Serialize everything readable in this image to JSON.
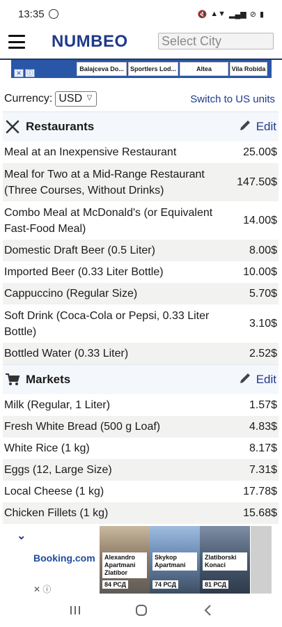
{
  "status_bar": {
    "time": "13:35"
  },
  "header": {
    "logo": "NUMBEO",
    "city_placeholder": "Select City"
  },
  "ad_strip": {
    "cards": [
      "Balajceva Do...",
      "Sportlers Lod...",
      "Altea",
      "Vila Robida"
    ]
  },
  "currency": {
    "label": "Currency:",
    "selected": "USD",
    "units_link": "Switch to US units"
  },
  "restaurants": {
    "title": "Restaurants",
    "edit": "Edit",
    "items": [
      {
        "label": "Meal at an Inexpensive Restaurant",
        "price": "25.00$"
      },
      {
        "label": "Meal for Two at a Mid-Range Restaurant (Three Courses, Without Drinks)",
        "price": "147.50$"
      },
      {
        "label": "Combo Meal at McDonald's (or Equivalent Fast-Food Meal)",
        "price": "14.00$"
      },
      {
        "label": "Domestic Draft Beer (0.5 Liter)",
        "price": "8.00$"
      },
      {
        "label": "Imported Beer (0.33 Liter Bottle)",
        "price": "10.00$"
      },
      {
        "label": "Cappuccino (Regular Size)",
        "price": "5.70$"
      },
      {
        "label": "Soft Drink (Coca-Cola or Pepsi, 0.33 Liter Bottle)",
        "price": "3.10$"
      },
      {
        "label": "Bottled Water (0.33 Liter)",
        "price": "2.52$"
      }
    ]
  },
  "markets": {
    "title": "Markets",
    "edit": "Edit",
    "items": [
      {
        "label": "Milk (Regular, 1 Liter)",
        "price": "1.57$"
      },
      {
        "label": "Fresh White Bread (500 g Loaf)",
        "price": "4.83$"
      },
      {
        "label": "White Rice (1 kg)",
        "price": "8.17$"
      },
      {
        "label": "Eggs (12, Large Size)",
        "price": "7.31$"
      },
      {
        "label": "Local Cheese (1 kg)",
        "price": "17.78$"
      },
      {
        "label": "Chicken Fillets (1 kg)",
        "price": "15.68$"
      }
    ]
  },
  "booking_ad": {
    "brand": "Booking.com",
    "hotels": [
      {
        "name": "Alexandro Apartmani Zlatibor",
        "price": "84 РСД"
      },
      {
        "name": "Skykop Apartmani",
        "price": "74 РСД"
      },
      {
        "name": "Zlatiborski Konaci",
        "price": "81 РСД"
      }
    ]
  }
}
